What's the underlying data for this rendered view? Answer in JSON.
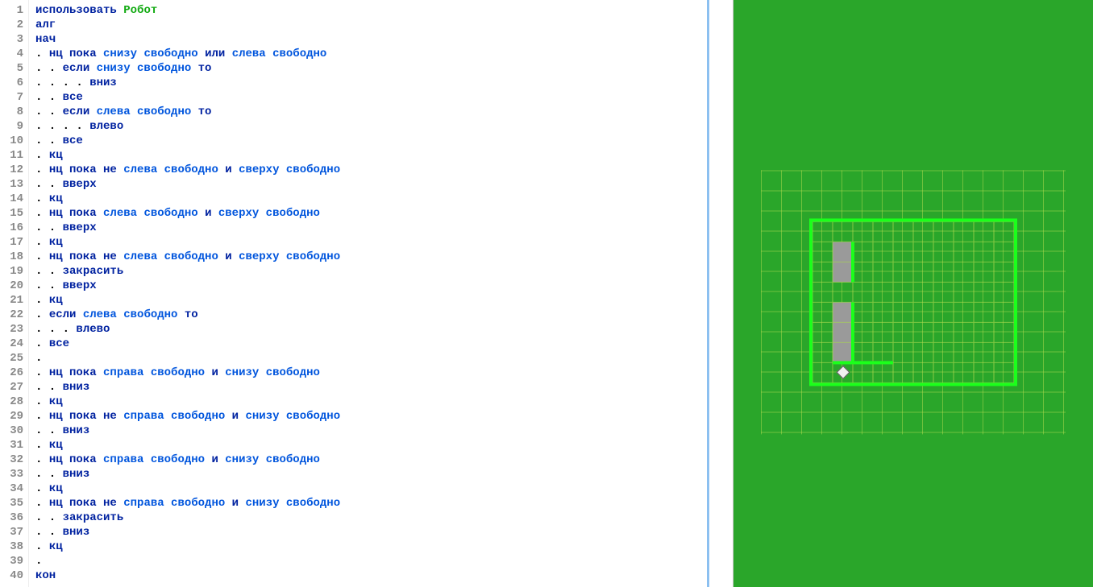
{
  "code": {
    "lines": [
      {
        "n": 1,
        "tokens": [
          {
            "t": "использовать",
            "c": "kw"
          },
          {
            "t": " ",
            "c": "txt"
          },
          {
            "t": "Робот",
            "c": "lib"
          }
        ]
      },
      {
        "n": 2,
        "tokens": [
          {
            "t": "алг",
            "c": "kw"
          }
        ]
      },
      {
        "n": 3,
        "tokens": [
          {
            "t": "нач",
            "c": "kw"
          }
        ]
      },
      {
        "n": 4,
        "tokens": [
          {
            "t": ". ",
            "c": "dots"
          },
          {
            "t": "нц пока",
            "c": "kw"
          },
          {
            "t": " ",
            "c": "txt"
          },
          {
            "t": "снизу свободно",
            "c": "cond"
          },
          {
            "t": " ",
            "c": "txt"
          },
          {
            "t": "или",
            "c": "kw"
          },
          {
            "t": " ",
            "c": "txt"
          },
          {
            "t": "слева свободно",
            "c": "cond"
          }
        ]
      },
      {
        "n": 5,
        "tokens": [
          {
            "t": ". . ",
            "c": "dots"
          },
          {
            "t": "если",
            "c": "kw"
          },
          {
            "t": " ",
            "c": "txt"
          },
          {
            "t": "снизу свободно",
            "c": "cond"
          },
          {
            "t": " ",
            "c": "txt"
          },
          {
            "t": "то",
            "c": "kw"
          }
        ]
      },
      {
        "n": 6,
        "tokens": [
          {
            "t": ". . . . ",
            "c": "dots"
          },
          {
            "t": "вниз",
            "c": "kw"
          }
        ]
      },
      {
        "n": 7,
        "tokens": [
          {
            "t": ". . ",
            "c": "dots"
          },
          {
            "t": "все",
            "c": "kw"
          }
        ]
      },
      {
        "n": 8,
        "tokens": [
          {
            "t": ". . ",
            "c": "dots"
          },
          {
            "t": "если",
            "c": "kw"
          },
          {
            "t": " ",
            "c": "txt"
          },
          {
            "t": "слева свободно",
            "c": "cond"
          },
          {
            "t": " ",
            "c": "txt"
          },
          {
            "t": "то",
            "c": "kw"
          }
        ]
      },
      {
        "n": 9,
        "tokens": [
          {
            "t": ". . . . ",
            "c": "dots"
          },
          {
            "t": "влево",
            "c": "kw"
          }
        ]
      },
      {
        "n": 10,
        "tokens": [
          {
            "t": ". . ",
            "c": "dots"
          },
          {
            "t": "все",
            "c": "kw"
          }
        ]
      },
      {
        "n": 11,
        "tokens": [
          {
            "t": ". ",
            "c": "dots"
          },
          {
            "t": "кц",
            "c": "kw"
          }
        ]
      },
      {
        "n": 12,
        "tokens": [
          {
            "t": ". ",
            "c": "dots"
          },
          {
            "t": "нц пока не",
            "c": "kw"
          },
          {
            "t": " ",
            "c": "txt"
          },
          {
            "t": "слева свободно",
            "c": "cond"
          },
          {
            "t": " ",
            "c": "txt"
          },
          {
            "t": "и",
            "c": "kw"
          },
          {
            "t": " ",
            "c": "txt"
          },
          {
            "t": "сверху свободно",
            "c": "cond"
          }
        ]
      },
      {
        "n": 13,
        "tokens": [
          {
            "t": ". . ",
            "c": "dots"
          },
          {
            "t": "вверх",
            "c": "kw"
          }
        ]
      },
      {
        "n": 14,
        "tokens": [
          {
            "t": ". ",
            "c": "dots"
          },
          {
            "t": "кц",
            "c": "kw"
          }
        ]
      },
      {
        "n": 15,
        "tokens": [
          {
            "t": ". ",
            "c": "dots"
          },
          {
            "t": "нц пока",
            "c": "kw"
          },
          {
            "t": " ",
            "c": "txt"
          },
          {
            "t": "слева свободно",
            "c": "cond"
          },
          {
            "t": " ",
            "c": "txt"
          },
          {
            "t": "и",
            "c": "kw"
          },
          {
            "t": " ",
            "c": "txt"
          },
          {
            "t": "сверху свободно",
            "c": "cond"
          }
        ]
      },
      {
        "n": 16,
        "tokens": [
          {
            "t": ". . ",
            "c": "dots"
          },
          {
            "t": "вверх",
            "c": "kw"
          }
        ]
      },
      {
        "n": 17,
        "tokens": [
          {
            "t": ". ",
            "c": "dots"
          },
          {
            "t": "кц",
            "c": "kw"
          }
        ]
      },
      {
        "n": 18,
        "tokens": [
          {
            "t": ". ",
            "c": "dots"
          },
          {
            "t": "нц пока не",
            "c": "kw"
          },
          {
            "t": " ",
            "c": "txt"
          },
          {
            "t": "слева свободно",
            "c": "cond"
          },
          {
            "t": " ",
            "c": "txt"
          },
          {
            "t": "и",
            "c": "kw"
          },
          {
            "t": " ",
            "c": "txt"
          },
          {
            "t": "сверху свободно",
            "c": "cond"
          }
        ]
      },
      {
        "n": 19,
        "tokens": [
          {
            "t": ". . ",
            "c": "dots"
          },
          {
            "t": "закрасить",
            "c": "kw"
          }
        ]
      },
      {
        "n": 20,
        "tokens": [
          {
            "t": ". . ",
            "c": "dots"
          },
          {
            "t": "вверх",
            "c": "kw"
          }
        ]
      },
      {
        "n": 21,
        "tokens": [
          {
            "t": ". ",
            "c": "dots"
          },
          {
            "t": "кц",
            "c": "kw"
          }
        ]
      },
      {
        "n": 22,
        "tokens": [
          {
            "t": ". ",
            "c": "dots"
          },
          {
            "t": "если",
            "c": "kw"
          },
          {
            "t": " ",
            "c": "txt"
          },
          {
            "t": "слева свободно",
            "c": "cond"
          },
          {
            "t": " ",
            "c": "txt"
          },
          {
            "t": "то",
            "c": "kw"
          }
        ]
      },
      {
        "n": 23,
        "tokens": [
          {
            "t": ". . . ",
            "c": "dots"
          },
          {
            "t": "влево",
            "c": "kw"
          }
        ]
      },
      {
        "n": 24,
        "tokens": [
          {
            "t": ". ",
            "c": "dots"
          },
          {
            "t": "все",
            "c": "kw"
          }
        ]
      },
      {
        "n": 25,
        "tokens": [
          {
            "t": ".",
            "c": "dots"
          }
        ]
      },
      {
        "n": 26,
        "tokens": [
          {
            "t": ". ",
            "c": "dots"
          },
          {
            "t": "нц пока",
            "c": "kw"
          },
          {
            "t": " ",
            "c": "txt"
          },
          {
            "t": "справа свободно",
            "c": "cond"
          },
          {
            "t": " ",
            "c": "txt"
          },
          {
            "t": "и",
            "c": "kw"
          },
          {
            "t": " ",
            "c": "txt"
          },
          {
            "t": "снизу свободно",
            "c": "cond"
          }
        ]
      },
      {
        "n": 27,
        "tokens": [
          {
            "t": ". . ",
            "c": "dots"
          },
          {
            "t": "вниз",
            "c": "kw"
          }
        ]
      },
      {
        "n": 28,
        "tokens": [
          {
            "t": ". ",
            "c": "dots"
          },
          {
            "t": "кц",
            "c": "kw"
          }
        ]
      },
      {
        "n": 29,
        "tokens": [
          {
            "t": ". ",
            "c": "dots"
          },
          {
            "t": "нц пока не",
            "c": "kw"
          },
          {
            "t": " ",
            "c": "txt"
          },
          {
            "t": "справа свободно",
            "c": "cond"
          },
          {
            "t": " ",
            "c": "txt"
          },
          {
            "t": "и",
            "c": "kw"
          },
          {
            "t": " ",
            "c": "txt"
          },
          {
            "t": "снизу свободно",
            "c": "cond"
          }
        ]
      },
      {
        "n": 30,
        "tokens": [
          {
            "t": ". . ",
            "c": "dots"
          },
          {
            "t": "вниз",
            "c": "kw"
          }
        ]
      },
      {
        "n": 31,
        "tokens": [
          {
            "t": ". ",
            "c": "dots"
          },
          {
            "t": "кц",
            "c": "kw"
          }
        ]
      },
      {
        "n": 32,
        "tokens": [
          {
            "t": ". ",
            "c": "dots"
          },
          {
            "t": "нц пока",
            "c": "kw"
          },
          {
            "t": " ",
            "c": "txt"
          },
          {
            "t": "справа свободно",
            "c": "cond"
          },
          {
            "t": " ",
            "c": "txt"
          },
          {
            "t": "и",
            "c": "kw"
          },
          {
            "t": " ",
            "c": "txt"
          },
          {
            "t": "снизу свободно",
            "c": "cond"
          }
        ]
      },
      {
        "n": 33,
        "tokens": [
          {
            "t": ". . ",
            "c": "dots"
          },
          {
            "t": "вниз",
            "c": "kw"
          }
        ]
      },
      {
        "n": 34,
        "tokens": [
          {
            "t": ". ",
            "c": "dots"
          },
          {
            "t": "кц",
            "c": "kw"
          }
        ]
      },
      {
        "n": 35,
        "tokens": [
          {
            "t": ". ",
            "c": "dots"
          },
          {
            "t": "нц пока не",
            "c": "kw"
          },
          {
            "t": " ",
            "c": "txt"
          },
          {
            "t": "справа свободно",
            "c": "cond"
          },
          {
            "t": " ",
            "c": "txt"
          },
          {
            "t": "и",
            "c": "kw"
          },
          {
            "t": " ",
            "c": "txt"
          },
          {
            "t": "снизу свободно",
            "c": "cond"
          }
        ]
      },
      {
        "n": 36,
        "tokens": [
          {
            "t": ". . ",
            "c": "dots"
          },
          {
            "t": "закрасить",
            "c": "kw"
          }
        ]
      },
      {
        "n": 37,
        "tokens": [
          {
            "t": ". . ",
            "c": "dots"
          },
          {
            "t": "вниз",
            "c": "kw"
          }
        ]
      },
      {
        "n": 38,
        "tokens": [
          {
            "t": ". ",
            "c": "dots"
          },
          {
            "t": "кц",
            "c": "kw"
          }
        ]
      },
      {
        "n": 39,
        "tokens": [
          {
            "t": ".",
            "c": "dots"
          }
        ]
      },
      {
        "n": 40,
        "tokens": [
          {
            "t": "кон",
            "c": "kw"
          }
        ]
      }
    ]
  },
  "field": {
    "cols": 10,
    "rows": 8,
    "cellSize": 25,
    "painted": [
      {
        "r": 1,
        "c": 1
      },
      {
        "r": 2,
        "c": 1
      },
      {
        "r": 4,
        "c": 1
      },
      {
        "r": 5,
        "c": 1
      },
      {
        "r": 6,
        "c": 1
      }
    ],
    "innerWalls": [
      {
        "side": "right",
        "r0": 1,
        "r1": 2,
        "c": 1
      },
      {
        "side": "right",
        "r0": 4,
        "r1": 6,
        "c": 1
      },
      {
        "side": "bottom",
        "c0": 1,
        "c1": 3,
        "r": 6
      }
    ],
    "robot": {
      "r": 7,
      "c": 1
    }
  }
}
